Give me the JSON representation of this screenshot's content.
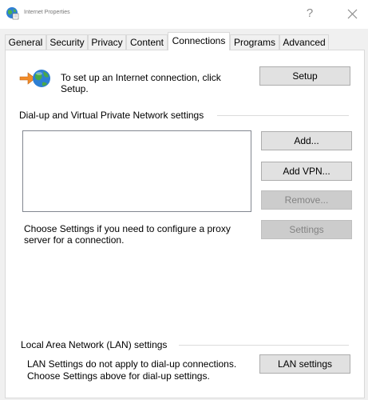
{
  "window": {
    "title": "Internet Properties",
    "help_glyph": "?",
    "icons": {
      "app": "internet-globe-icon",
      "close": "close-icon"
    }
  },
  "tabs": [
    {
      "label": "General",
      "active": false
    },
    {
      "label": "Security",
      "active": false
    },
    {
      "label": "Privacy",
      "active": false
    },
    {
      "label": "Content",
      "active": false
    },
    {
      "label": "Connections",
      "active": true
    },
    {
      "label": "Programs",
      "active": false
    },
    {
      "label": "Advanced",
      "active": false
    }
  ],
  "setup": {
    "icon": "internet-connection-wizard-icon",
    "line1": "To set up an Internet connection, click",
    "line2": "Setup.",
    "button": "Setup"
  },
  "dialup": {
    "header": "Dial-up and Virtual Private Network settings",
    "items": [],
    "add_button": "Add...",
    "add_vpn_button": "Add VPN...",
    "remove_button": "Remove...",
    "proxy_line1": "Choose Settings if you need to configure a proxy",
    "proxy_line2": "server for a connection.",
    "settings_button": "Settings"
  },
  "lan": {
    "header": "Local Area Network (LAN) settings",
    "line1": "LAN Settings do not apply to dial-up connections.",
    "line2": "Choose Settings above for dial-up settings.",
    "button": "LAN settings"
  },
  "colors": {
    "dialog_bg": "#f0f0f0",
    "panel_bg": "#ffffff",
    "button_bg": "#e1e1e1",
    "button_border": "#adadad",
    "disabled_text": "#838383"
  }
}
